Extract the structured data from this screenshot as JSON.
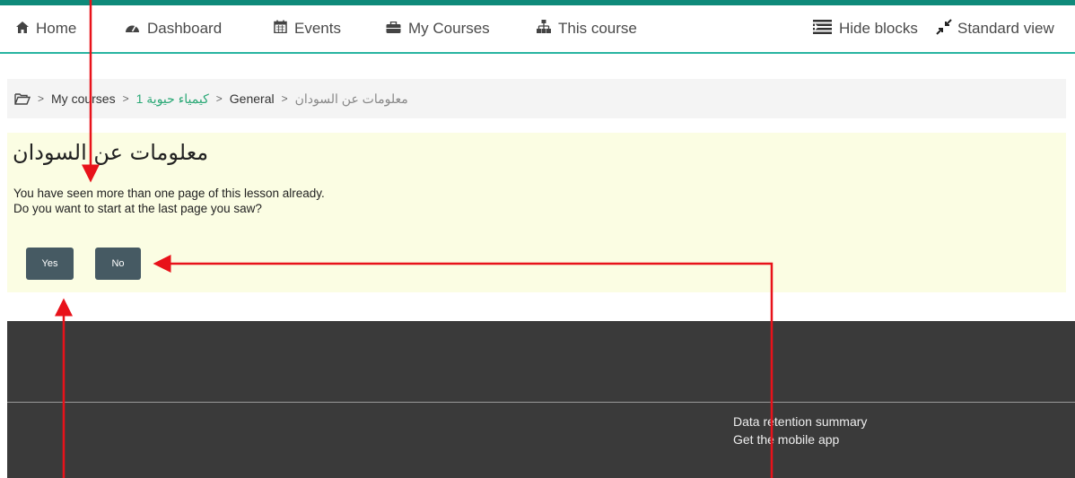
{
  "nav": {
    "home": "Home",
    "dashboard": "Dashboard",
    "events": "Events",
    "my_courses": "My Courses",
    "this_course": "This course",
    "hide_blocks": "Hide blocks",
    "standard_view": "Standard view"
  },
  "breadcrumb": {
    "my_courses": "My courses",
    "course": "كيمياء حيوية 1",
    "general": "General",
    "current": "معلومات عن السودان"
  },
  "lesson": {
    "title": "معلومات عن السودان",
    "message_line1": "You have seen more than one page of this lesson already.",
    "message_line2": "Do you want to start at the last page you saw?",
    "yes_label": "Yes",
    "no_label": "No"
  },
  "footer": {
    "data_retention": "Data retention summary",
    "mobile_app": "Get the mobile app"
  },
  "colors": {
    "accent": "#28b4a1",
    "button": "#465a63",
    "annotation": "#e8121a"
  },
  "icons": {
    "home": "home-icon",
    "dashboard": "tachometer-icon",
    "events": "calendar-icon",
    "my_courses": "briefcase-icon",
    "this_course": "sitemap-icon",
    "hide_blocks": "list-indent-icon",
    "standard_view": "compress-icon",
    "breadcrumb": "folder-open-icon"
  }
}
